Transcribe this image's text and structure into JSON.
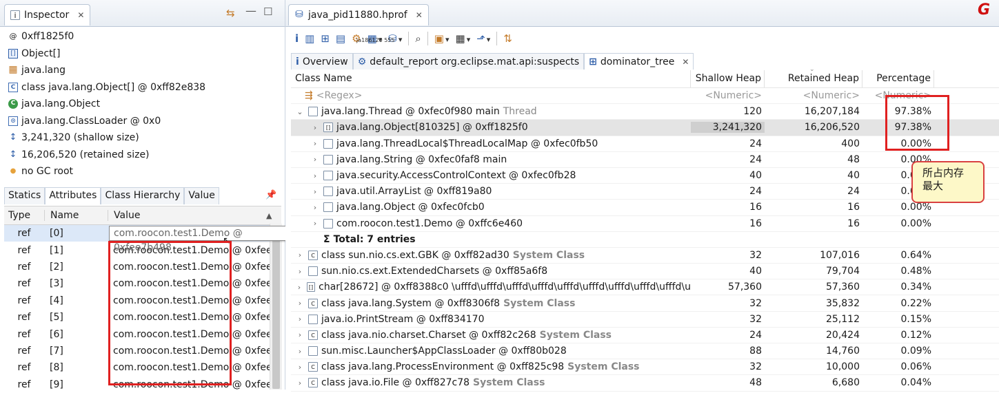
{
  "inspector": {
    "tab_title": "Inspector",
    "lines": [
      {
        "icon": "at-icon",
        "text": "0xff1825f0"
      },
      {
        "icon": "array-icon",
        "text": "Object[]"
      },
      {
        "icon": "package-icon",
        "text": "java.lang"
      },
      {
        "icon": "class-icon",
        "text": "class java.lang.Object[] @ 0xff82e838"
      },
      {
        "icon": "superclass-icon",
        "text": "java.lang.Object"
      },
      {
        "icon": "classloader-icon",
        "text": "java.lang.ClassLoader @ 0x0"
      },
      {
        "icon": "size-icon",
        "text": "3,241,320 (shallow size)"
      },
      {
        "icon": "size-icon",
        "text": "16,206,520 (retained size)"
      },
      {
        "icon": "gc-root-icon",
        "text": "no GC root"
      }
    ],
    "subtabs": [
      "Statics",
      "Attributes",
      "Class Hierarchy",
      "Value"
    ],
    "columns": [
      "Type",
      "Name",
      "Value"
    ],
    "rows": [
      {
        "type": "ref",
        "name": "[0]",
        "value": "com.roocon.test1.Demo @ 0xfee7b498"
      },
      {
        "type": "ref",
        "name": "[1]",
        "value": "com.roocon.test1.Demo @ 0xfee7"
      },
      {
        "type": "ref",
        "name": "[2]",
        "value": "com.roocon.test1.Demo @ 0xfee7"
      },
      {
        "type": "ref",
        "name": "[3]",
        "value": "com.roocon.test1.Demo @ 0xfee7"
      },
      {
        "type": "ref",
        "name": "[4]",
        "value": "com.roocon.test1.Demo @ 0xfee7"
      },
      {
        "type": "ref",
        "name": "[5]",
        "value": "com.roocon.test1.Demo @ 0xfee7"
      },
      {
        "type": "ref",
        "name": "[6]",
        "value": "com.roocon.test1.Demo @ 0xfee7"
      },
      {
        "type": "ref",
        "name": "[7]",
        "value": "com.roocon.test1.Demo @ 0xfee7"
      },
      {
        "type": "ref",
        "name": "[8]",
        "value": "com.roocon.test1.Demo @ 0xfee7"
      },
      {
        "type": "ref",
        "name": "[9]",
        "value": "com.roocon.test1.Demo @ 0xfee7"
      }
    ],
    "tooltip": "com.roocon.test1.Demo @ 0xfee7b498"
  },
  "editor": {
    "tab_title": "java_pid11880.hprof",
    "toolbar_tiny": "ja186120  555",
    "inner_tabs": [
      {
        "label": "Overview",
        "icon": "info-icon"
      },
      {
        "label": "default_report  org.eclipse.mat.api:suspects",
        "icon": "report-icon"
      },
      {
        "label": "dominator_tree",
        "icon": "tree-icon"
      }
    ],
    "columns": [
      "Class Name",
      "Shallow Heap",
      "Retained Heap",
      "Percentage"
    ],
    "filters": {
      "name": "<Regex>",
      "shallow": "<Numeric>",
      "retained": "<Numeric>",
      "pct": "<Numeric>"
    },
    "rows": [
      {
        "indent": 0,
        "arrow": "⌄",
        "name": "java.lang.Thread @ 0xfec0f980  main",
        "suffix": "Thread",
        "suffix_style": "thread",
        "shallow": "120",
        "retained": "16,207,184",
        "pct": "97.38%"
      },
      {
        "indent": 1,
        "arrow": "›",
        "name": "java.lang.Object[810325] @ 0xff1825f0",
        "suffix": "",
        "shallow": "3,241,320",
        "retained": "16,206,520",
        "pct": "97.38%",
        "sel": true
      },
      {
        "indent": 1,
        "arrow": "›",
        "name": "java.lang.ThreadLocal$ThreadLocalMap @ 0xfec0fb50",
        "suffix": "",
        "shallow": "24",
        "retained": "400",
        "pct": "0.00%"
      },
      {
        "indent": 1,
        "arrow": "›",
        "name": "java.lang.String @ 0xfec0faf8  main",
        "suffix": "",
        "shallow": "24",
        "retained": "48",
        "pct": "0.00%"
      },
      {
        "indent": 1,
        "arrow": "›",
        "name": "java.security.AccessControlContext @ 0xfec0fb28",
        "suffix": "",
        "shallow": "40",
        "retained": "40",
        "pct": "0.00%"
      },
      {
        "indent": 1,
        "arrow": "›",
        "name": "java.util.ArrayList @ 0xff819a80",
        "suffix": "",
        "shallow": "24",
        "retained": "24",
        "pct": "0.00%"
      },
      {
        "indent": 1,
        "arrow": "›",
        "name": "java.lang.Object @ 0xfec0fcb0",
        "suffix": "",
        "shallow": "16",
        "retained": "16",
        "pct": "0.00%"
      },
      {
        "indent": 1,
        "arrow": "›",
        "name": "com.roocon.test1.Demo @ 0xffc6e460",
        "suffix": "",
        "shallow": "16",
        "retained": "16",
        "pct": "0.00%"
      },
      {
        "indent": 1,
        "arrow": "",
        "name": "Total: 7 entries",
        "suffix": "",
        "shallow": "",
        "retained": "",
        "pct": "",
        "total": true
      },
      {
        "indent": 0,
        "arrow": "›",
        "name": "class sun.nio.cs.ext.GBK @ 0xff82ad30",
        "suffix": "System Class",
        "suffix_style": "sys",
        "shallow": "32",
        "retained": "107,016",
        "pct": "0.64%"
      },
      {
        "indent": 0,
        "arrow": "›",
        "name": "sun.nio.cs.ext.ExtendedCharsets @ 0xff85a6f8",
        "suffix": "",
        "shallow": "40",
        "retained": "79,704",
        "pct": "0.48%"
      },
      {
        "indent": 0,
        "arrow": "›",
        "name": "char[28672] @ 0xff8388c0  \\ufffd\\ufffd\\ufffd\\ufffd\\ufffd\\ufffd\\ufffd\\ufffd\\ufffd\\u",
        "suffix": "",
        "shallow": "57,360",
        "retained": "57,360",
        "pct": "0.34%"
      },
      {
        "indent": 0,
        "arrow": "›",
        "name": "class java.lang.System @ 0xff8306f8",
        "suffix": "System Class",
        "suffix_style": "sys",
        "shallow": "32",
        "retained": "35,832",
        "pct": "0.22%"
      },
      {
        "indent": 0,
        "arrow": "›",
        "name": "java.io.PrintStream @ 0xff834170",
        "suffix": "",
        "shallow": "32",
        "retained": "25,112",
        "pct": "0.15%"
      },
      {
        "indent": 0,
        "arrow": "›",
        "name": "class java.nio.charset.Charset @ 0xff82c268",
        "suffix": "System Class",
        "suffix_style": "sys",
        "shallow": "24",
        "retained": "20,424",
        "pct": "0.12%"
      },
      {
        "indent": 0,
        "arrow": "›",
        "name": "sun.misc.Launcher$AppClassLoader @ 0xff80b028",
        "suffix": "",
        "shallow": "88",
        "retained": "14,760",
        "pct": "0.09%"
      },
      {
        "indent": 0,
        "arrow": "›",
        "name": "class java.lang.ProcessEnvironment @ 0xff825c98",
        "suffix": "System Class",
        "suffix_style": "sys",
        "shallow": "32",
        "retained": "10,000",
        "pct": "0.06%"
      },
      {
        "indent": 0,
        "arrow": "›",
        "name": "class java.io.File @ 0xff827c78",
        "suffix": "System Class",
        "suffix_style": "sys",
        "shallow": "48",
        "retained": "6,680",
        "pct": "0.04%"
      }
    ]
  },
  "callout": {
    "line1": "所占内存",
    "line2": "最大"
  },
  "colors": {
    "highlight_red": "#e02020",
    "callout_bg": "#fdf8c8",
    "accent": "#2e5ea8"
  }
}
